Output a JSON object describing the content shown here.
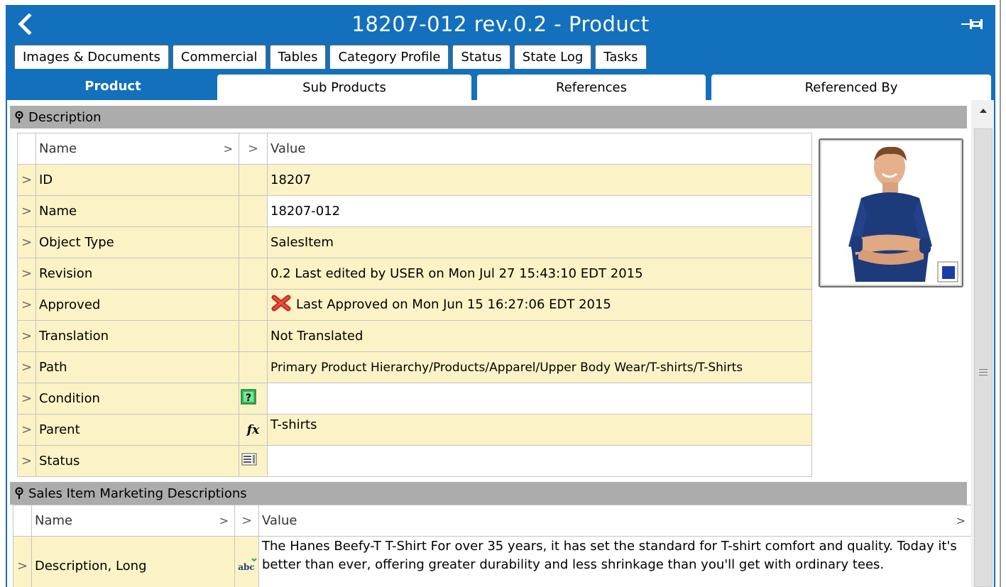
{
  "window": {
    "title": "18207-012 rev.0.2 - Product"
  },
  "tabs_top": [
    "Images & Documents",
    "Commercial",
    "Tables",
    "Category Profile",
    "Status",
    "State Log",
    "Tasks"
  ],
  "tabs_main": [
    "Product",
    "Sub Products",
    "References",
    "Referenced By"
  ],
  "active_tab": "Product",
  "colors": {
    "accent": "#1370bd",
    "row_yellow": "#fbf3c6",
    "section_header": "#acacac"
  },
  "description": {
    "header": "Description",
    "col_name": "Name",
    "col_value": "Value",
    "rows": [
      {
        "name": "ID",
        "value": "18207"
      },
      {
        "name": "Name",
        "value": "18207-012"
      },
      {
        "name": "Object Type",
        "value": "SalesItem"
      },
      {
        "name": "Revision",
        "value": "0.2 Last edited by USER on Mon Jul 27 15:43:10 EDT 2015"
      },
      {
        "name": "Approved",
        "value": "Last Approved on Mon Jun 15 16:27:06 EDT 2015"
      },
      {
        "name": "Translation",
        "value": "Not Translated"
      },
      {
        "name": "Path",
        "value": "Primary Product Hierarchy/Products/Apparel/Upper Body Wear/T-shirts/T-Shirts"
      },
      {
        "name": "Condition",
        "value": ""
      },
      {
        "name": "Parent",
        "value": "T-shirts"
      },
      {
        "name": "Status",
        "value": ""
      }
    ]
  },
  "marketing": {
    "header": "Sales Item Marketing Descriptions",
    "col_name": "Name",
    "col_value": "Value",
    "rows": [
      {
        "name": "Description, Long",
        "value": "The Hanes Beefy-T T-Shirt For over 35 years, it has set the standard for T-shirt comfort and quality. Today it's better than ever, offering greater durability and less shrinkage than you'll get with ordinary tees."
      }
    ]
  },
  "icons": {
    "back": "chevron-left-icon",
    "pin": "pin-icon",
    "approved": "red-x-icon",
    "condition": "question-icon",
    "parent": "fx-icon",
    "status": "form-icon",
    "long_desc": "abc-text-icon"
  }
}
